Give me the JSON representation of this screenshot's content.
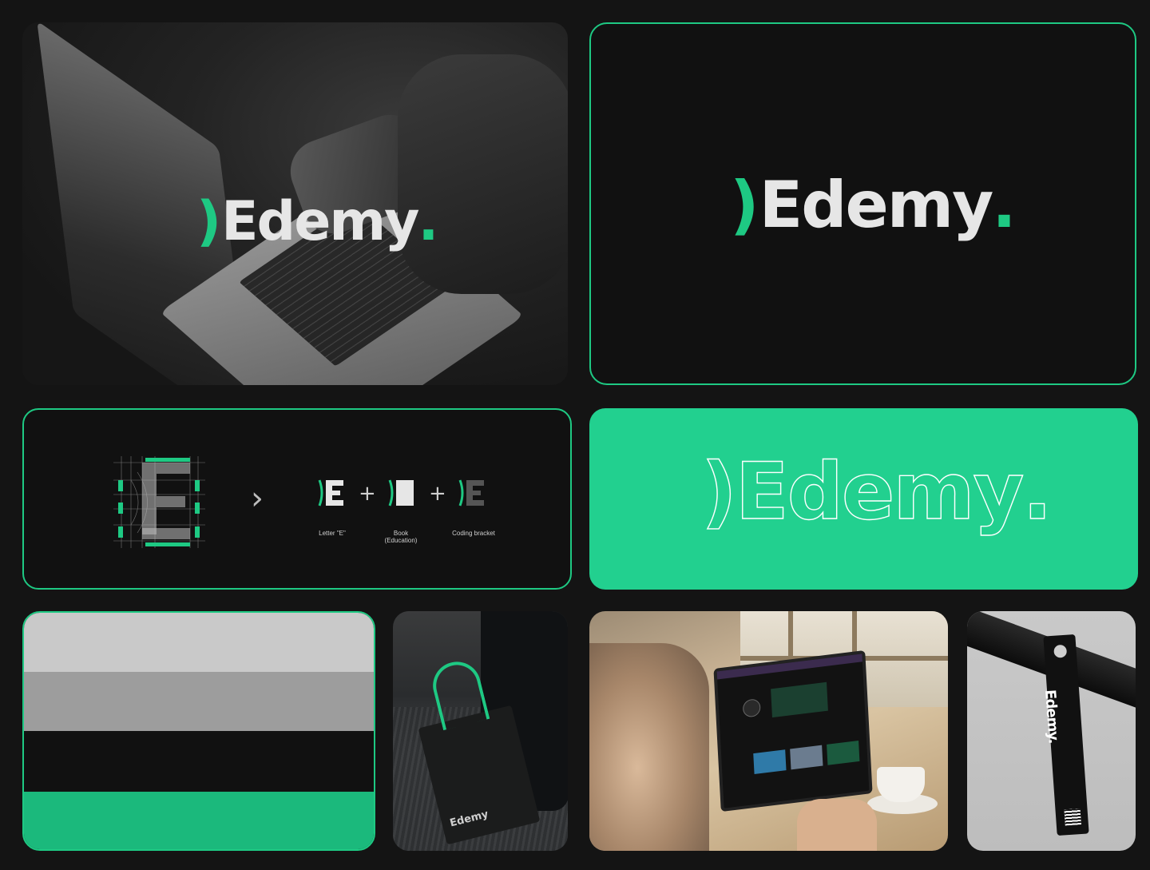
{
  "brand": {
    "bracket": ")",
    "name": "Edemy",
    "dot": ".",
    "accent_color": "#1ec983",
    "mint_color": "#22d08f"
  },
  "construction": {
    "items": [
      {
        "label": "Letter \"E\""
      },
      {
        "label": "Book (Education)"
      },
      {
        "label": "Coding bracket"
      }
    ],
    "arrow_icon": "chevron-right-icon",
    "plus_sign": "+"
  },
  "palette": {
    "colors": [
      "#c9c9c9",
      "#9d9d9d",
      "#111111",
      "#1bb97c"
    ]
  },
  "mockups": {
    "tote_text": "Edemy",
    "tag_text": "Edemy."
  }
}
